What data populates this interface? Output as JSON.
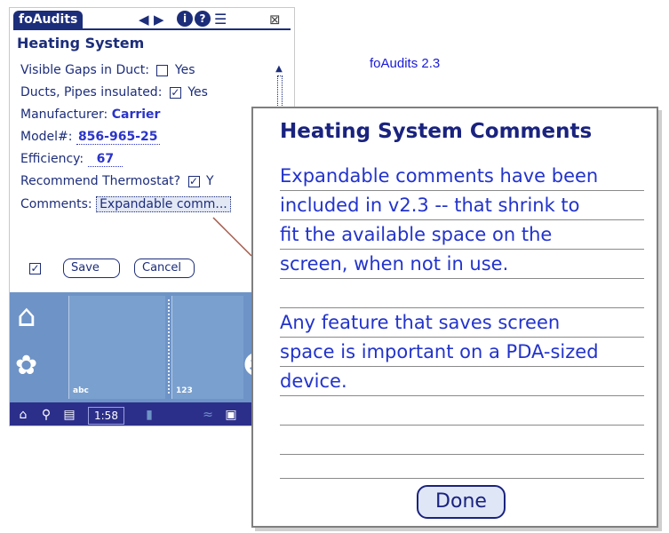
{
  "app": {
    "title": "foAudits",
    "version_label": "foAudits 2.3"
  },
  "titlebar_icons": {
    "prev": "◀",
    "next": "▶",
    "info": "i",
    "help": "?",
    "list": "☰",
    "close": "⊠"
  },
  "form": {
    "section_title": "Heating System",
    "fields": [
      {
        "label": "Visible Gaps in Duct:",
        "checked": false,
        "check_glyph": "",
        "option_text": "Yes"
      },
      {
        "label": "Ducts, Pipes insulated:",
        "checked": true,
        "check_glyph": "✓",
        "option_text": "Yes"
      },
      {
        "label": "Manufacturer:",
        "value": "Carrier"
      },
      {
        "label": "Model#:",
        "value": "856-965-25"
      },
      {
        "label": "Efficiency:",
        "value": "67"
      },
      {
        "label": "Recommend Thermostat?",
        "checked": true,
        "check_glyph": "✓",
        "option_text": "Y"
      },
      {
        "label": "Comments:",
        "value": "Expandable comm..."
      }
    ],
    "scroll_up": "▲",
    "scroll_down": "▼",
    "save_checkbox_glyph": "✓",
    "save_label": "Save",
    "cancel_label": "Cancel"
  },
  "graffiti": {
    "abc_label": "abc",
    "num_label": "123",
    "home_icon": "⌂",
    "menu_icon": "✿",
    "calc_icon": "☻"
  },
  "statusbar": {
    "home_icon": "⌂",
    "find_icon": "⚲",
    "menu_icon": "▤",
    "time": "1:58",
    "battery_icon": "▮",
    "signal_icon": "≈",
    "device_icon": "▣"
  },
  "dialog": {
    "title": "Heating System Comments",
    "lines": [
      "Expandable comments have been",
      "included in v2.3 -- that shrink to",
      "fit the available space on the",
      "screen, when not in use.",
      "",
      "Any feature that saves screen",
      "space is important on a PDA-sized",
      "device.",
      "",
      "",
      ""
    ],
    "done_label": "Done"
  },
  "colors": {
    "accent": "#1c2d7a",
    "value_blue": "#2b34c9",
    "graffiti_blue": "#6e93c6",
    "statusbar": "#2c2f8a",
    "connector": "#a05a4a"
  }
}
